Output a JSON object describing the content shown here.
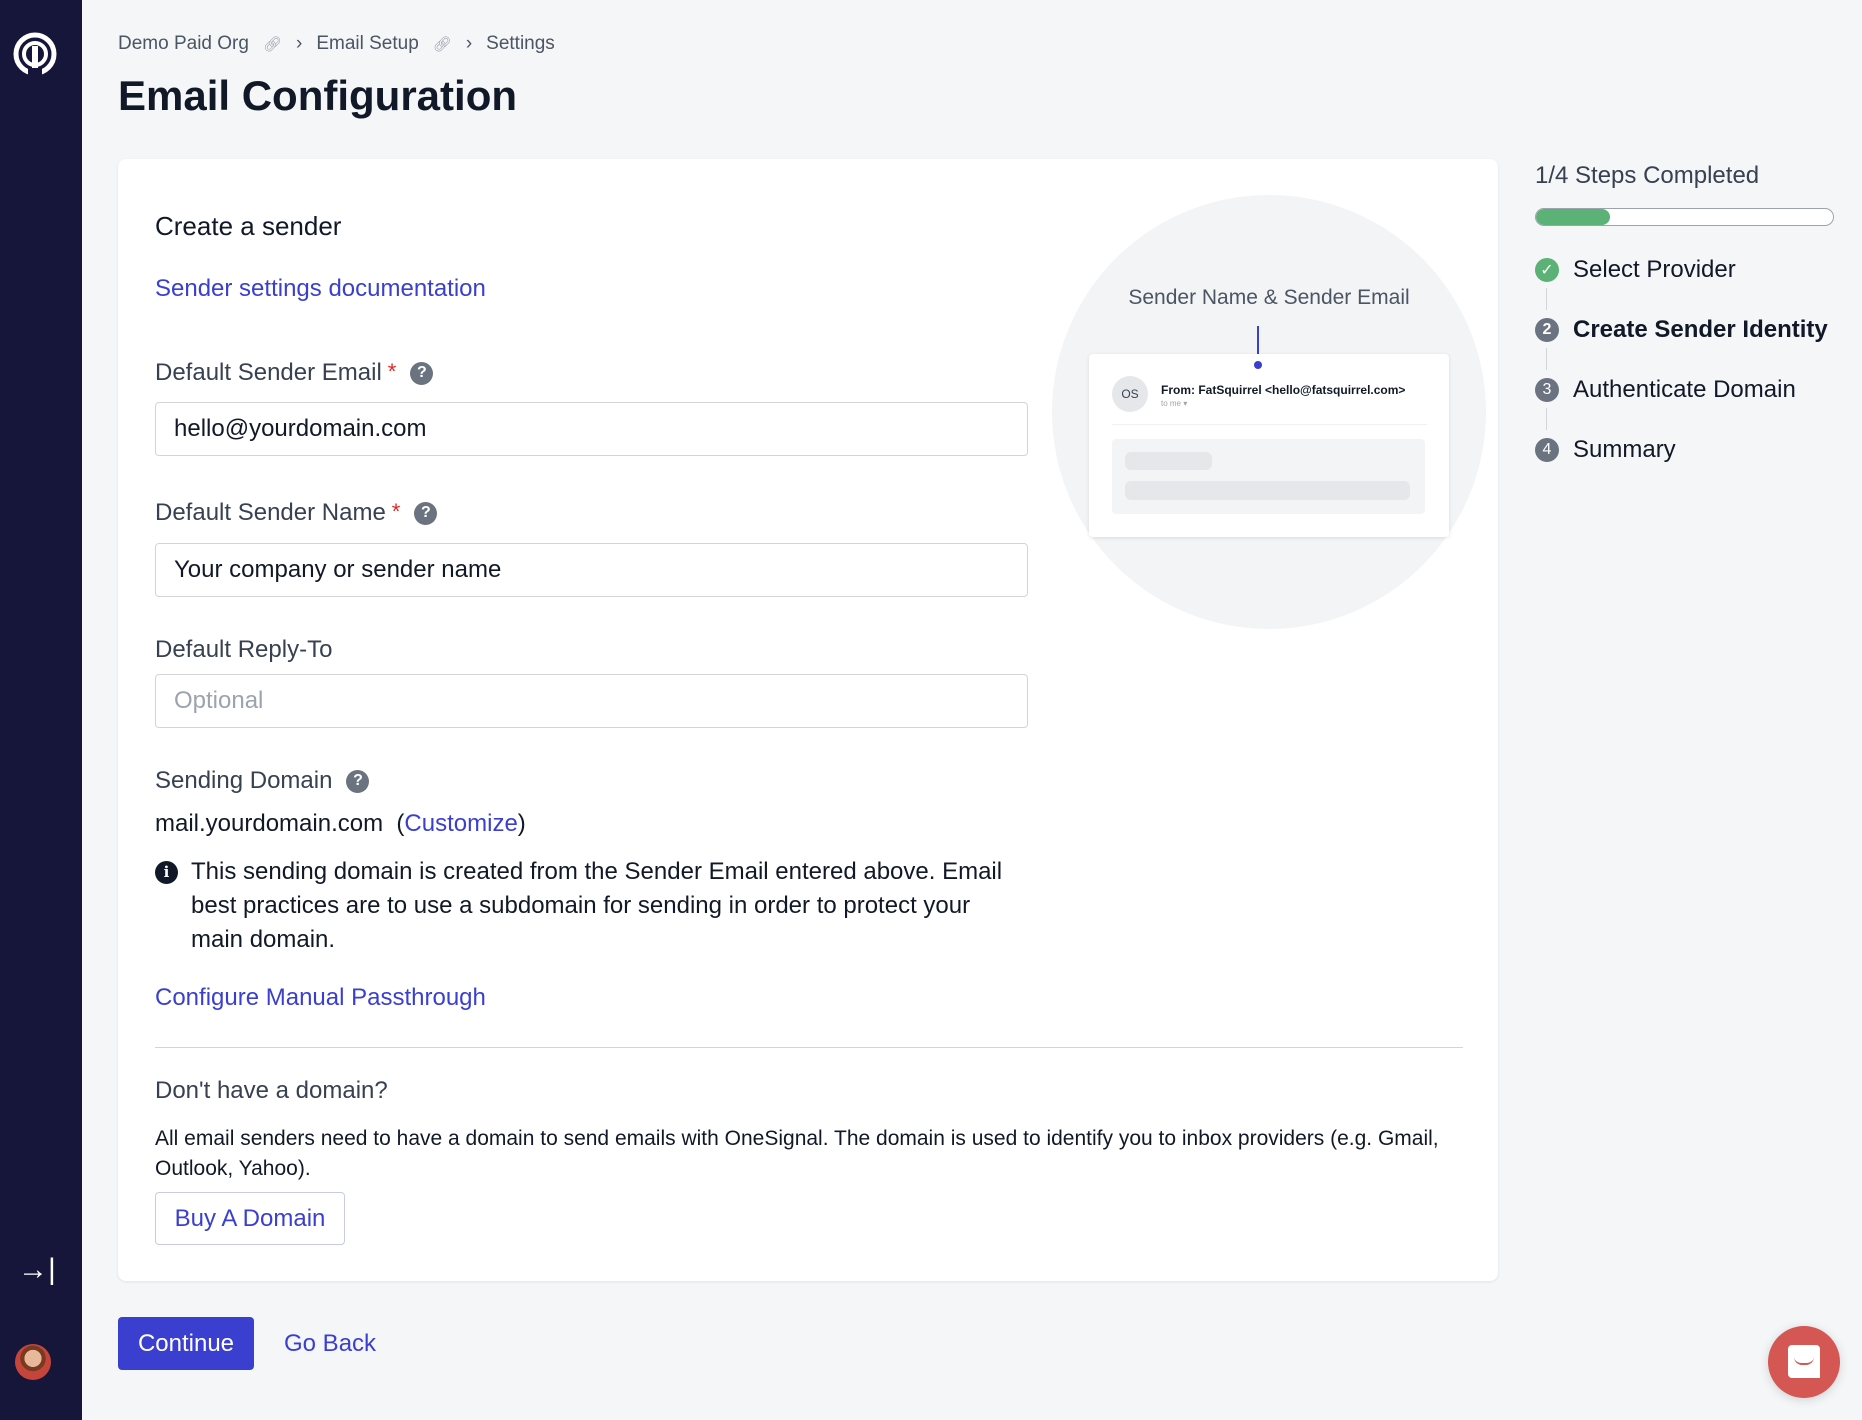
{
  "breadcrumb": [
    "Demo Paid Org",
    "Email Setup",
    "Settings"
  ],
  "page_title": "Email Configuration",
  "card": {
    "heading": "Create a sender",
    "doc_link": "Sender settings documentation",
    "email_label": "Default Sender Email",
    "email_value": "hello@yourdomain.com",
    "name_label": "Default Sender Name",
    "name_value": "Your company or sender name",
    "reply_label": "Default Reply-To",
    "reply_placeholder": "Optional",
    "domain_label": "Sending Domain",
    "domain_value": "mail.yourdomain.com",
    "customize": "Customize",
    "info_text": "This sending domain is created from the Sender Email entered above. Email best practices are to use a subdomain for sending in order to protect your main domain.",
    "passthrough_link": "Configure Manual Passthrough",
    "no_domain_heading": "Don't have a domain?",
    "no_domain_text": "All email senders need to have a domain to send emails with OneSignal. The domain is used to identify you to inbox providers (e.g. Gmail, Outlook, Yahoo).",
    "buy_button": "Buy A Domain"
  },
  "preview": {
    "label": "Sender Name & Sender Email",
    "avatar": "OS",
    "from": "From: FatSquirrel <hello@fatsquirrel.com>",
    "to": "to me ▾"
  },
  "actions": {
    "continue": "Continue",
    "back": "Go Back"
  },
  "progress": {
    "title": "1/4 Steps Completed",
    "fraction": 0.25,
    "color": "#5cb176",
    "steps": [
      {
        "num": "✓",
        "label": "Select Provider",
        "state": "done"
      },
      {
        "num": "2",
        "label": "Create Sender Identity",
        "state": "current"
      },
      {
        "num": "3",
        "label": "Authenticate Domain",
        "state": "todo"
      },
      {
        "num": "4",
        "label": "Summary",
        "state": "todo"
      }
    ]
  },
  "colors": {
    "accent": "#3a3fd0",
    "sidebar": "#15163a",
    "chat": "#d45753"
  }
}
